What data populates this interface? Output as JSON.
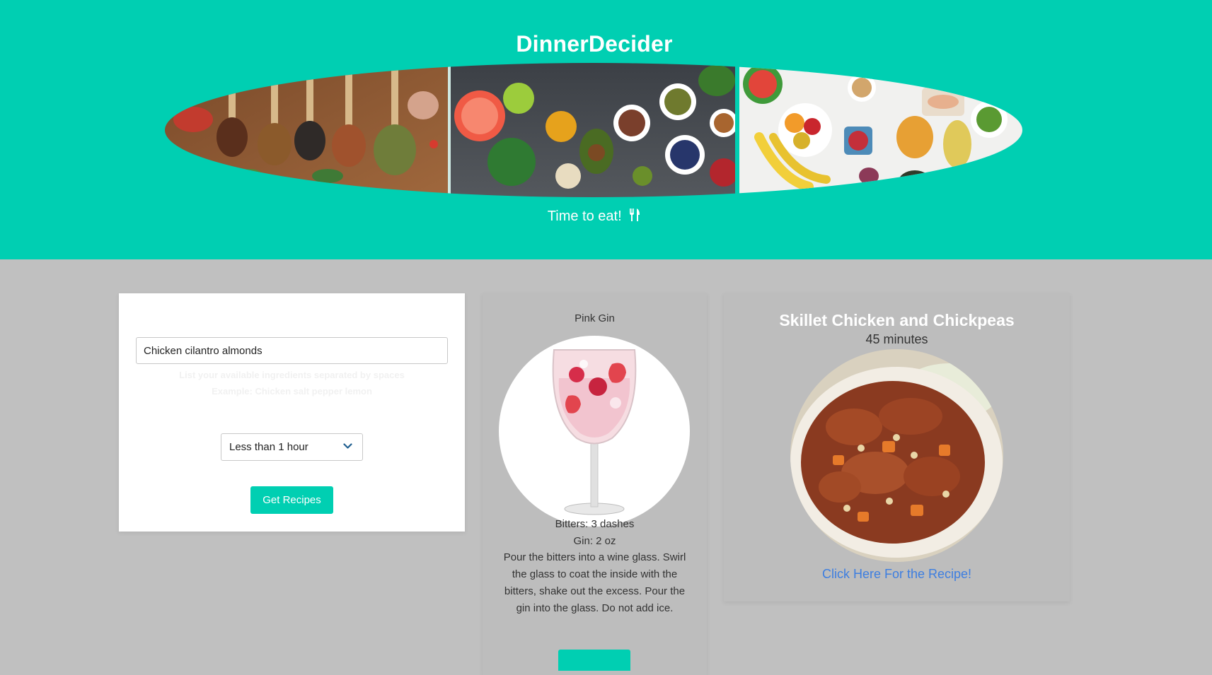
{
  "header": {
    "title": "DinnerDecider",
    "tagline": "Time to eat!",
    "tagline_icon": "fork-knife-icon",
    "banner_images": [
      "spices-on-spoons-image",
      "vegetables-and-bowls-image",
      "fruits-and-produce-image"
    ]
  },
  "search": {
    "input_value": "Chicken cilantro almonds",
    "hint_line1": "List your available ingredients separated by spaces",
    "hint_line2": "Example: Chicken salt pepper lemon",
    "time_select": {
      "selected": "Less than 1 hour"
    },
    "submit_label": "Get Recipes"
  },
  "drink": {
    "name": "Pink Gin",
    "image": "pink-gin-glass-image",
    "ingredients": [
      "Bitters: 3 dashes",
      "Gin: 2 oz"
    ],
    "instructions": "Pour the bitters into a wine glass. Swirl the glass to coat the inside with the bitters, shake out the excess. Pour the gin into the glass. Do not add ice."
  },
  "recipe": {
    "title": "Skillet Chicken and Chickpeas",
    "time": "45 minutes",
    "image": "skillet-chicken-dish-image",
    "link_label": "Click Here For the Recipe!"
  },
  "colors": {
    "accent": "#00cfb2",
    "page_background": "#c0c0c0",
    "link": "#3d7ee0"
  }
}
